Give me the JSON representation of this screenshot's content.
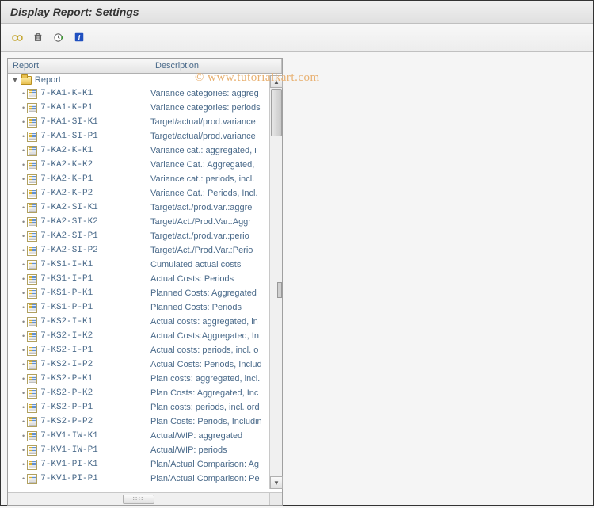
{
  "window": {
    "title": "Display Report: Settings"
  },
  "watermark": "© www.tutorialkart.com",
  "toolbar": {
    "glasses_icon": "glasses-icon",
    "delete_icon": "trash-icon",
    "execute_icon": "clock-arrow-icon",
    "info_icon": "info-icon"
  },
  "tree": {
    "header": {
      "report": "Report",
      "description": "Description"
    },
    "root_label": "Report",
    "rows": [
      {
        "code": "7-KA1-K-K1",
        "desc": "Variance categories: aggreg"
      },
      {
        "code": "7-KA1-K-P1",
        "desc": "Variance categories: periods"
      },
      {
        "code": "7-KA1-SI-K1",
        "desc": "Target/actual/prod.variance"
      },
      {
        "code": "7-KA1-SI-P1",
        "desc": "Target/actual/prod.variance"
      },
      {
        "code": "7-KA2-K-K1",
        "desc": "Variance cat.: aggregated, i"
      },
      {
        "code": "7-KA2-K-K2",
        "desc": "Variance Cat.: Aggregated,"
      },
      {
        "code": "7-KA2-K-P1",
        "desc": "Variance cat.: periods, incl."
      },
      {
        "code": "7-KA2-K-P2",
        "desc": "Variance Cat.: Periods, Incl."
      },
      {
        "code": "7-KA2-SI-K1",
        "desc": "Target/act./prod.var.:aggre"
      },
      {
        "code": "7-KA2-SI-K2",
        "desc": "Target/Act./Prod.Var.:Aggr"
      },
      {
        "code": "7-KA2-SI-P1",
        "desc": "Target/act./prod.var.:perio"
      },
      {
        "code": "7-KA2-SI-P2",
        "desc": "Target/Act./Prod.Var.:Perio"
      },
      {
        "code": "7-KS1-I-K1",
        "desc": "Cumulated actual costs"
      },
      {
        "code": "7-KS1-I-P1",
        "desc": "Actual Costs: Periods"
      },
      {
        "code": "7-KS1-P-K1",
        "desc": "Planned Costs: Aggregated"
      },
      {
        "code": "7-KS1-P-P1",
        "desc": "Planned Costs: Periods"
      },
      {
        "code": "7-KS2-I-K1",
        "desc": "Actual costs: aggregated, in"
      },
      {
        "code": "7-KS2-I-K2",
        "desc": "Actual Costs:Aggregated, In"
      },
      {
        "code": "7-KS2-I-P1",
        "desc": "Actual costs: periods, incl. o"
      },
      {
        "code": "7-KS2-I-P2",
        "desc": "Actual Costs: Periods, Includ"
      },
      {
        "code": "7-KS2-P-K1",
        "desc": "Plan costs: aggregated, incl."
      },
      {
        "code": "7-KS2-P-K2",
        "desc": "Plan Costs: Aggregated, Inc"
      },
      {
        "code": "7-KS2-P-P1",
        "desc": "Plan costs: periods, incl. ord"
      },
      {
        "code": "7-KS2-P-P2",
        "desc": "Plan Costs: Periods, Includin"
      },
      {
        "code": "7-KV1-IW-K1",
        "desc": "Actual/WIP: aggregated"
      },
      {
        "code": "7-KV1-IW-P1",
        "desc": "Actual/WIP: periods"
      },
      {
        "code": "7-KV1-PI-K1",
        "desc": "Plan/Actual Comparison: Ag"
      },
      {
        "code": "7-KV1-PI-P1",
        "desc": "Plan/Actual Comparison: Pe"
      }
    ]
  }
}
